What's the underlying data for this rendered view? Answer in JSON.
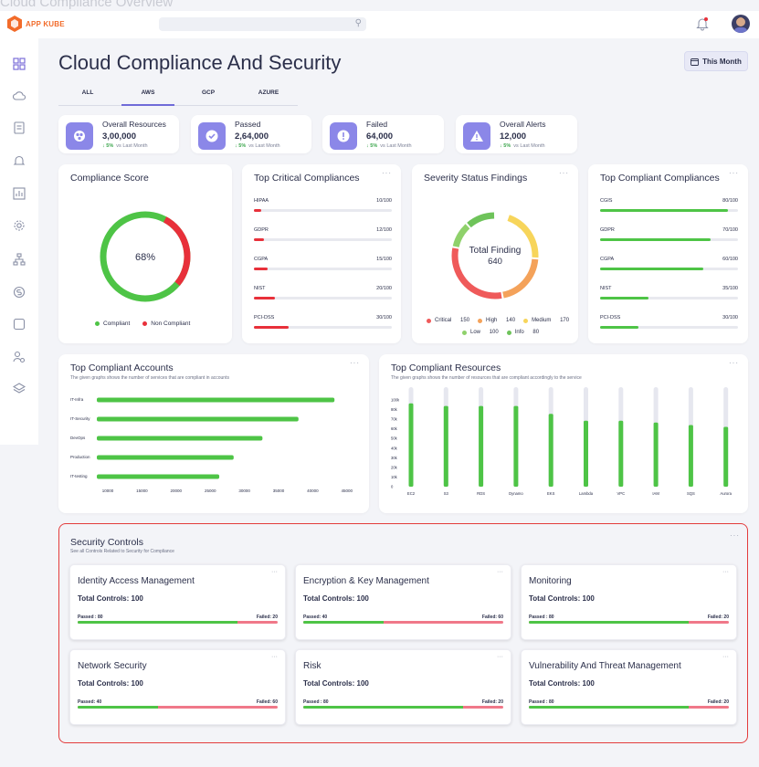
{
  "ghost_title": "Cloud Compliance Overview",
  "app": {
    "logo_text": "APP KUBE"
  },
  "header": {
    "search_placeholder": ""
  },
  "page": {
    "title": "Cloud Compliance And Security",
    "period_button": "This Month"
  },
  "tabs": [
    {
      "label": "ALL",
      "active": false
    },
    {
      "label": "AWS",
      "active": true
    },
    {
      "label": "GCP",
      "active": false
    },
    {
      "label": "AZURE",
      "active": false
    }
  ],
  "stats": [
    {
      "label": "Overall  Resources",
      "value": "3,00,000",
      "trend": "5%",
      "trend_note": "vs Last Month",
      "icon": "resources-icon"
    },
    {
      "label": "Passed",
      "value": "2,64,000",
      "trend": "5%",
      "trend_note": "vs Last Month",
      "icon": "check-icon"
    },
    {
      "label": "Failed",
      "value": "64,000",
      "trend": "5%",
      "trend_note": "vs Last Month",
      "icon": "alert-circle-icon"
    },
    {
      "label": "Overall Alerts",
      "value": "12,000",
      "trend": "5%",
      "trend_note": "vs Last Month",
      "icon": "warning-icon"
    }
  ],
  "compliance_score": {
    "title": "Compliance Score",
    "center": "68%",
    "legend": [
      "Compliant",
      "Non Compliant"
    ],
    "colors": {
      "compliant": "#4ec446",
      "non_compliant": "#e8303a"
    }
  },
  "critical_compliances": {
    "title": "Top Critical Compliances",
    "dots": "···",
    "items": [
      {
        "label": "HIPAA",
        "value": "10/100",
        "fraction": 0.05
      },
      {
        "label": "GDPR",
        "value": "12/100",
        "fraction": 0.07
      },
      {
        "label": "CGPA",
        "value": "15/100",
        "fraction": 0.1
      },
      {
        "label": "NIST",
        "value": "20/100",
        "fraction": 0.15
      },
      {
        "label": "PCI-DSS",
        "value": "30/100",
        "fraction": 0.25
      }
    ],
    "bar_color": "#e8303a"
  },
  "severity": {
    "title": "Severity Status Findings",
    "dots": "···",
    "center_title": "Total Finding",
    "center_value": "640",
    "legend": [
      {
        "label": "Critical",
        "value": "150",
        "color": "#ef5a5a"
      },
      {
        "label": "High",
        "value": "140",
        "color": "#f4a25a"
      },
      {
        "label": "Medium",
        "value": "170",
        "color": "#f7d55b"
      },
      {
        "label": "Low",
        "value": "100",
        "color": "#8fd16b"
      },
      {
        "label": "Info",
        "value": "80",
        "color": "#6ec35a"
      }
    ]
  },
  "compliant_compliances": {
    "title": "Top Compliant Compliances",
    "dots": "···",
    "items": [
      {
        "label": "CGIS",
        "value": "80/100",
        "fraction": 0.93
      },
      {
        "label": "GDPR",
        "value": "70/100",
        "fraction": 0.8
      },
      {
        "label": "CGPA",
        "value": "60/100",
        "fraction": 0.75
      },
      {
        "label": "NIST",
        "value": "35/100",
        "fraction": 0.35
      },
      {
        "label": "PCI-DSS",
        "value": "30/100",
        "fraction": 0.28
      }
    ],
    "bar_color": "#4ec446"
  },
  "compliant_accounts": {
    "title": "Top Compliant Accounts",
    "subtitle": "The given graphs shows the number of services that are compliant in accounts",
    "dots": "···"
  },
  "compliant_resources": {
    "title": "Top Compliant Resources",
    "subtitle": "The given graphs shows the number of resources that are compliant accordingly to the service",
    "dots": "···"
  },
  "chart_data": [
    {
      "type": "bar",
      "orientation": "horizontal",
      "categories": [
        "IT-Infra",
        "IT-Security",
        "DevOps",
        "Production",
        "IT-testing"
      ],
      "values": [
        43000,
        38000,
        33000,
        29000,
        27000
      ],
      "xticks": [
        "10000",
        "15000",
        "20000",
        "25000",
        "30000",
        "35000",
        "40000",
        "45000"
      ],
      "xlim": [
        10000,
        45000
      ],
      "color": "#4ec446"
    },
    {
      "type": "bar",
      "categories": [
        "EC2",
        "S3",
        "RDS",
        "Dynamo",
        "EKS",
        "Lambda",
        "VPC",
        "IAM",
        "SQS",
        "Aurora"
      ],
      "values": [
        96,
        93,
        93,
        93,
        84,
        76,
        76,
        74,
        71,
        69
      ],
      "yticks": [
        "100k",
        "80k",
        "70k",
        "60k",
        "50k",
        "40k",
        "30k",
        "20k",
        "10k",
        "0"
      ],
      "ylim": [
        0,
        100
      ],
      "color": "#4ec446",
      "track_color": "#e6e7ef"
    }
  ],
  "security_controls": {
    "title": "Security Controls",
    "subtitle": "See all Controls Related to Security for Compliance",
    "dots": "···",
    "cards": [
      {
        "name": "Identity Access Management",
        "total": "Total  Controls:  100",
        "passed": "Passed : 80",
        "failed": "Failed: 20",
        "pass_fraction": 0.8
      },
      {
        "name": "Encryption & Key Management",
        "total": "Total  Controls:  100",
        "passed": "Passed: 40",
        "failed": "Failed: 60",
        "pass_fraction": 0.4
      },
      {
        "name": "Monitoring",
        "total": "Total  Controls:  100",
        "passed": "Passed : 80",
        "failed": "Failed: 20",
        "pass_fraction": 0.8
      },
      {
        "name": "Network Security",
        "total": "Total  Controls:  100",
        "passed": "Passed: 40",
        "failed": "Failed: 60",
        "pass_fraction": 0.4
      },
      {
        "name": "Risk",
        "total": "Total  Controls:  100",
        "passed": "Passed : 80",
        "failed": "Failed: 20",
        "pass_fraction": 0.8
      },
      {
        "name": "Vulnerability And Threat Management",
        "total": "Total  Controls:  100",
        "passed": "Passed : 80",
        "failed": "Failed: 20",
        "pass_fraction": 0.8
      }
    ]
  }
}
